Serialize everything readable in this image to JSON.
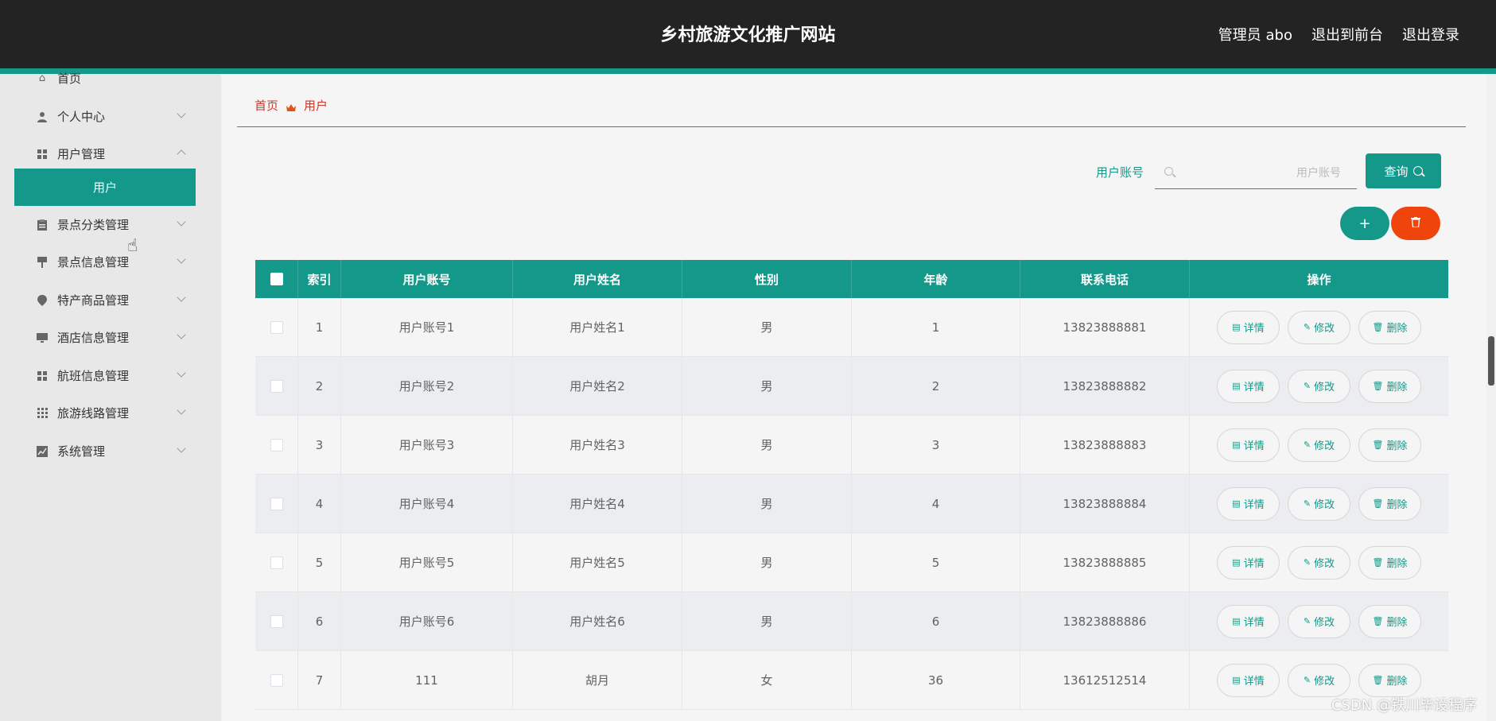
{
  "header": {
    "site_title": "乡村旅游文化推广网站",
    "links": [
      "管理员 abo",
      "退出到前台",
      "退出登录"
    ]
  },
  "sidebar": {
    "items": [
      {
        "label": "首页",
        "icon": "home-icon"
      },
      {
        "label": "个人中心",
        "icon": "user-icon"
      },
      {
        "label": "用户管理",
        "icon": "grid-icon"
      },
      {
        "label": "景点分类管理",
        "icon": "clipboard-icon"
      },
      {
        "label": "景点信息管理",
        "icon": "pin-icon"
      },
      {
        "label": "特产商品管理",
        "icon": "location-icon"
      },
      {
        "label": "酒店信息管理",
        "icon": "monitor-icon"
      },
      {
        "label": "航班信息管理",
        "icon": "grid-icon"
      },
      {
        "label": "旅游线路管理",
        "icon": "grid9-icon"
      },
      {
        "label": "系统管理",
        "icon": "chart-icon"
      }
    ],
    "active_sub": "用户"
  },
  "breadcrumb": {
    "home": "首页",
    "current": "用户"
  },
  "search": {
    "label": "用户账号",
    "placeholder": "用户账号",
    "button": "查询"
  },
  "actions": {
    "add": "+"
  },
  "table": {
    "columns": [
      "索引",
      "用户账号",
      "用户姓名",
      "性别",
      "年龄",
      "联系电话",
      "操作"
    ],
    "rows": [
      [
        "1",
        "用户账号1",
        "用户姓名1",
        "男",
        "1",
        "13823888881"
      ],
      [
        "2",
        "用户账号2",
        "用户姓名2",
        "男",
        "2",
        "13823888882"
      ],
      [
        "3",
        "用户账号3",
        "用户姓名3",
        "男",
        "3",
        "13823888883"
      ],
      [
        "4",
        "用户账号4",
        "用户姓名4",
        "男",
        "4",
        "13823888884"
      ],
      [
        "5",
        "用户账号5",
        "用户姓名5",
        "男",
        "5",
        "13823888885"
      ],
      [
        "6",
        "用户账号6",
        "用户姓名6",
        "男",
        "6",
        "13823888886"
      ],
      [
        "7",
        "111",
        "胡月",
        "女",
        "36",
        "13612512514"
      ]
    ],
    "op_labels": {
      "detail": "详情",
      "edit": "修改",
      "delete": "删除"
    }
  },
  "colors": {
    "accent": "#13988a",
    "danger": "#f0440d",
    "header_bg": "#232323",
    "breadcrumb": "#c83a2e"
  },
  "watermark": "CSDN @铁川毕设程序"
}
